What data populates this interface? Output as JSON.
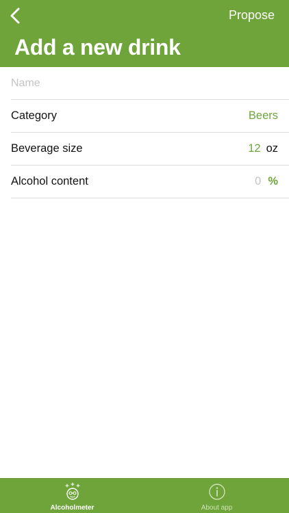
{
  "header": {
    "back_icon": "chevron-left-icon",
    "propose_label": "Propose",
    "title": "Add a new drink",
    "background": "#6ea43a"
  },
  "form": {
    "name": {
      "value": "",
      "placeholder": "Name"
    },
    "category": {
      "label": "Category",
      "value": "Beers"
    },
    "beverage_size": {
      "label": "Beverage size",
      "value": "12",
      "unit": "oz"
    },
    "alcohol_content": {
      "label": "Alcohol content",
      "value": "0",
      "unit": "%"
    }
  },
  "tabbar": {
    "tabs": [
      {
        "label": "Alcoholmeter",
        "icon": "dizzy-face-icon",
        "active": true
      },
      {
        "label": "About app",
        "icon": "info-icon",
        "active": false
      }
    ]
  },
  "colors": {
    "accent": "#6ea43a",
    "placeholder": "#c4c4c6",
    "divider": "#dcdcdc"
  }
}
